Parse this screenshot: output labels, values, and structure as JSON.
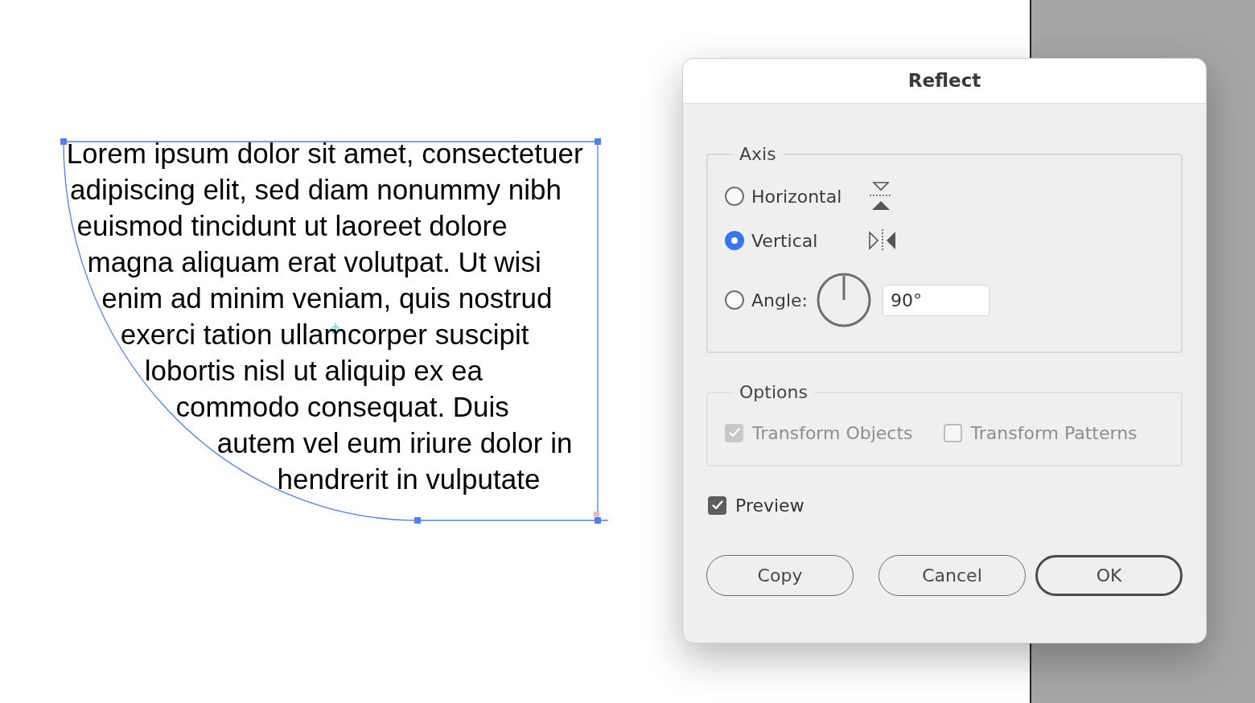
{
  "artboard": {
    "text_frame": {
      "lines": [
        "Lorem ipsum dolor sit amet, consectetuer",
        "adipiscing elit, sed diam nonummy nibh",
        "euismod tincidunt ut laoreet dolore",
        "magna aliquam erat volutpat. Ut wisi",
        "enim ad minim veniam, quis nostrud",
        "exerci tation ullamcorper suscipit",
        "lobortis nisl ut aliquip ex ea",
        "commodo consequat. Duis",
        "autem vel eum iriure dolor in",
        "hendrerit in vulputate"
      ]
    }
  },
  "dialog": {
    "title": "Reflect",
    "axis": {
      "label": "Axis",
      "options": [
        {
          "kind": "horizontal",
          "label": "Horizontal",
          "selected": false
        },
        {
          "kind": "vertical",
          "label": "Vertical",
          "selected": true
        },
        {
          "kind": "angle",
          "label": "Angle:",
          "selected": false,
          "value": "90°"
        }
      ]
    },
    "options": {
      "label": "Options",
      "checkboxes": [
        {
          "label": "Transform Objects",
          "checked": true,
          "disabled": true
        },
        {
          "label": "Transform Patterns",
          "checked": false,
          "disabled": true
        }
      ]
    },
    "preview": {
      "label": "Preview",
      "checked": true
    },
    "buttons": [
      {
        "label": "Copy",
        "default": false
      },
      {
        "label": "Cancel",
        "default": false
      },
      {
        "label": "OK",
        "default": true
      }
    ]
  }
}
